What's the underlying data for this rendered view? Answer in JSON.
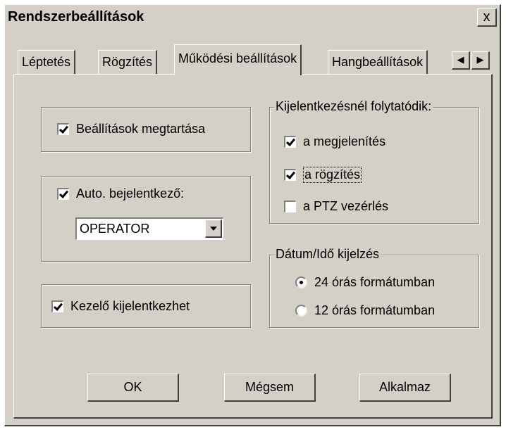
{
  "window": {
    "title": "Rendszerbeállítások",
    "close_label": "x"
  },
  "tabs": [
    {
      "label": "Léptetés"
    },
    {
      "label": "Rögzítés"
    },
    {
      "label": "Működési beállítások",
      "active": true
    },
    {
      "label": "Hangbeállítások"
    }
  ],
  "left": {
    "keep_settings": {
      "label": "Beállítások megtartása",
      "checked": true
    },
    "auto_login": {
      "label": "Auto. bejelentkező:",
      "checked": true
    },
    "auto_login_user": {
      "value": "OPERATOR"
    },
    "operator_logout": {
      "label": "Kezelő kijelentkezhet",
      "checked": true
    }
  },
  "logout_group": {
    "title": "Kijelentkezésnél folytatódik:",
    "items": [
      {
        "label": "a megjelenítés",
        "checked": true
      },
      {
        "label": "a rögzítés",
        "checked": true
      },
      {
        "label": "a PTZ vezérlés",
        "checked": false
      }
    ]
  },
  "datetime_group": {
    "title": "Dátum/Idő kijelzés",
    "options": [
      {
        "label": "24 órás formátumban",
        "selected": true
      },
      {
        "label": "12 órás formátumban",
        "selected": false
      }
    ]
  },
  "buttons": {
    "ok": "OK",
    "cancel": "Mégsem",
    "apply": "Alkalmaz"
  }
}
